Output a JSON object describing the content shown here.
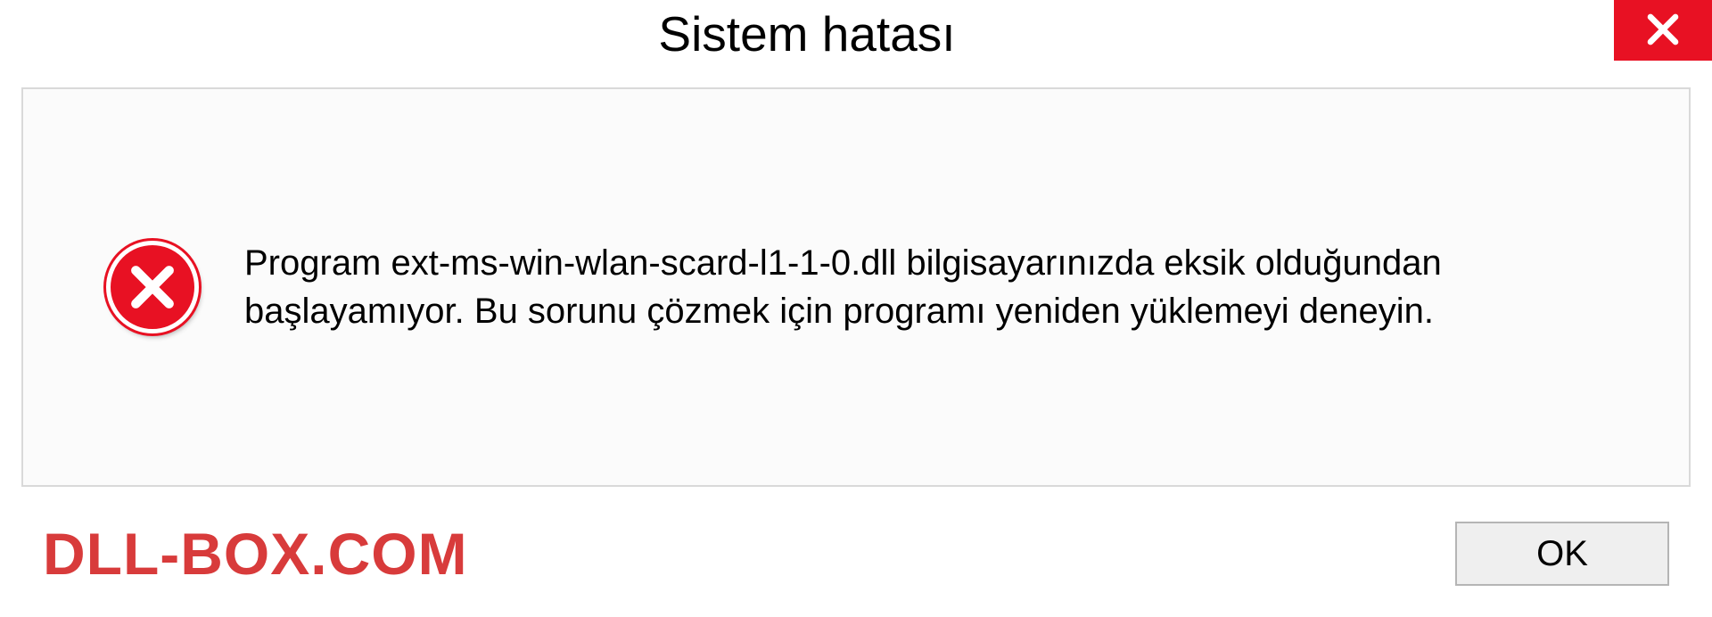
{
  "dialog": {
    "title": "Sistem hatası",
    "message": "Program ext-ms-win-wlan-scard-l1-1-0.dll bilgisayarınızda eksik olduğundan başlayamıyor. Bu sorunu çözmek için programı yeniden yüklemeyi deneyin.",
    "ok_label": "OK"
  },
  "watermark": "DLL-BOX.COM",
  "colors": {
    "close_red": "#e81123",
    "watermark_red": "#d83b3b",
    "panel_border": "#d9d9d9"
  }
}
